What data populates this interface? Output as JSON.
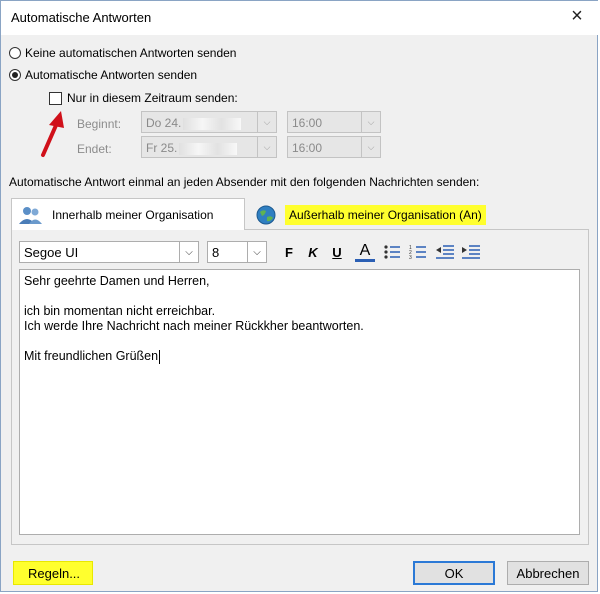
{
  "window": {
    "title": "Automatische Antworten",
    "close_glyph": "×"
  },
  "options": {
    "no_auto_reply": "Keine automatischen Antworten senden",
    "send_auto_reply": "Automatische Antworten senden",
    "time_range_only": "Nur in diesem Zeitraum senden:",
    "time_range_checked": false,
    "selected": "send_auto_reply"
  },
  "schedule": {
    "start_label": "Beginnt:",
    "start_date": "Do 24.",
    "start_time": "16:00",
    "end_label": "Endet:",
    "end_date": "Fr 25.",
    "end_time": "16:00"
  },
  "instruction": "Automatische Antwort einmal an jeden Absender mit den folgenden Nachrichten senden:",
  "tabs": {
    "inside": "Innerhalb meiner Organisation",
    "outside": "Außerhalb meiner Organisation (An)",
    "active": "inside"
  },
  "toolbar": {
    "font": "Segoe UI",
    "size": "8",
    "bold": "F",
    "italic": "K",
    "underline": "U",
    "font_color": "A"
  },
  "message": {
    "line1": "Sehr geehrte Damen und Herren,",
    "line2": "",
    "line3": "ich bin momentan nicht erreichbar.",
    "line4": "Ich werde Ihre Nachricht nach meiner Rückkher beantworten.",
    "line5": "",
    "line6": "Mit freundlichen Grüßen"
  },
  "buttons": {
    "rules": "Regeln...",
    "ok": "OK",
    "cancel": "Abbrechen"
  },
  "colors": {
    "highlight": "#ffff2e",
    "arrow": "#d0101a",
    "ok_border": "#2b79d6"
  }
}
